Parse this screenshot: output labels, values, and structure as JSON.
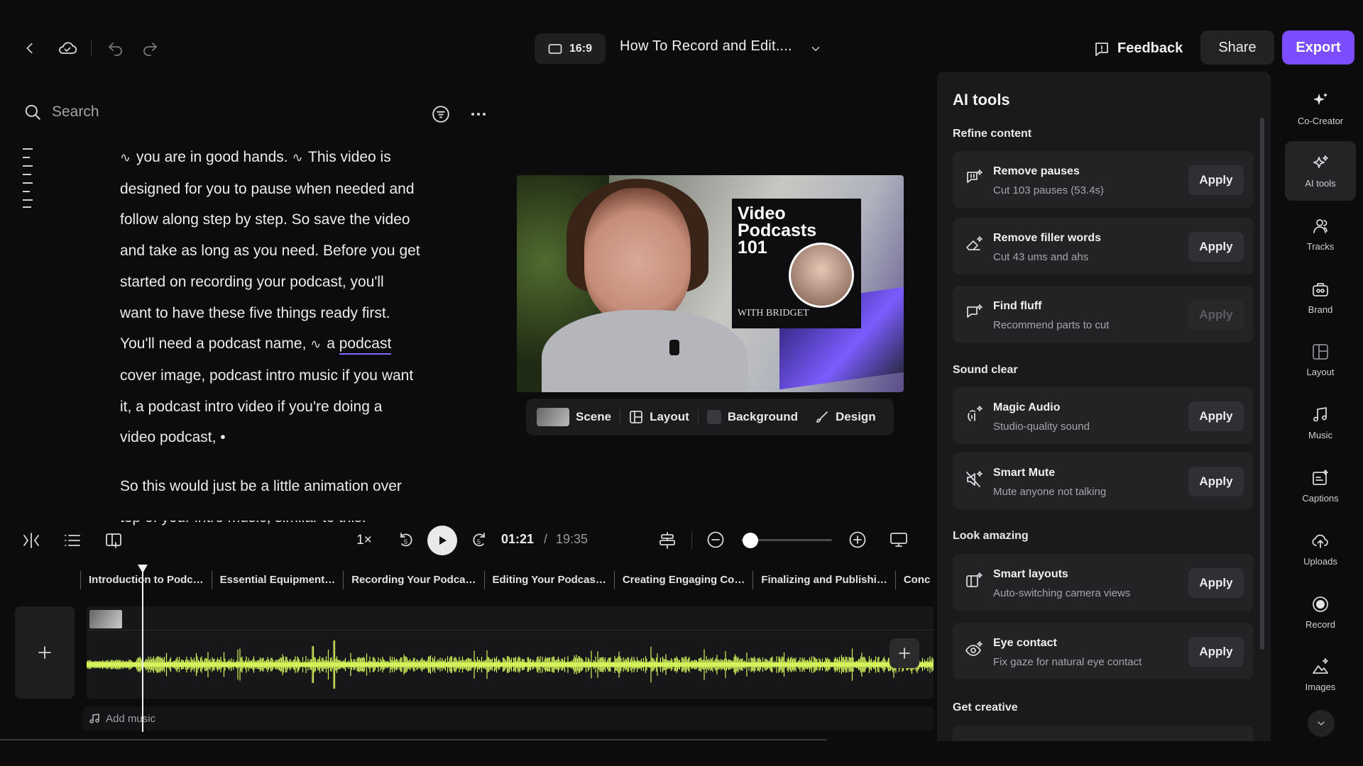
{
  "topbar": {
    "aspect_ratio": "16:9",
    "project_title": "How To Record and Edit....",
    "feedback_label": "Feedback",
    "share_label": "Share",
    "export_label": "Export"
  },
  "script_panel": {
    "search_placeholder": "Search",
    "paragraph1": {
      "l1": "you are in good hands.",
      "l1b": "This video is",
      "l2": "designed for you to pause when needed and",
      "l3": "follow along step by  step. So save the video",
      "l4": "and take as long as you need. Before you get",
      "l5": "started on recording your podcast, you'll",
      "l6": "want to have these five things ready first.",
      "l7": "You'll need a podcast name,",
      "l7b": "a",
      "l7link": "podcast",
      "l8": "cover image, podcast intro music if you want",
      "l9": "it, a podcast intro video if you're doing a",
      "l10": "video podcast,",
      "l10end": "•"
    },
    "paragraph2": {
      "l1": "So this would just be a little animation over",
      "l2": "top of your intro music, similar to this."
    }
  },
  "preview": {
    "cover_title_line1": "Video",
    "cover_title_line2": "Podcasts",
    "cover_title_line3": "101",
    "cover_subtitle": "WITH BRIDGET"
  },
  "scene_bar": {
    "scene_label": "Scene",
    "layout_label": "Layout",
    "background_label": "Background",
    "design_label": "Design"
  },
  "playback": {
    "speed": "1×",
    "current_time": "01:21",
    "separator": "/",
    "total_time": "19:35",
    "zoom_level": 0.1
  },
  "timeline": {
    "chapters": [
      "Introduction to Podc…",
      "Essential Equipment…",
      "Recording Your Podca…",
      "Editing Your Podcas…",
      "Creating Engaging Co…",
      "Finalizing and Publishi…",
      "Conc"
    ],
    "add_music_label": "Add music"
  },
  "ai_panel": {
    "title": "AI tools",
    "sections": {
      "refine": "Refine content",
      "sound": "Sound clear",
      "look": "Look amazing",
      "creative": "Get creative"
    },
    "tools": [
      {
        "title": "Remove pauses",
        "subtitle": "Cut 103 pauses (53.4s)",
        "action": "Apply"
      },
      {
        "title": "Remove filler words",
        "subtitle": "Cut 43 ums and ahs",
        "action": "Apply"
      },
      {
        "title": "Find fluff",
        "subtitle": "Recommend parts to cut",
        "action": "Apply"
      },
      {
        "title": "Magic Audio",
        "subtitle": "Studio-quality sound",
        "action": "Apply"
      },
      {
        "title": "Smart Mute",
        "subtitle": "Mute anyone not talking",
        "action": "Apply"
      },
      {
        "title": "Smart layouts",
        "subtitle": "Auto-switching camera views",
        "action": "Apply"
      },
      {
        "title": "Eye contact",
        "subtitle": "Fix gaze for natural eye contact",
        "action": "Apply"
      }
    ]
  },
  "rail": {
    "items": [
      "Co-Creator",
      "AI tools",
      "Tracks",
      "Brand",
      "Layout",
      "Music",
      "Captions",
      "Uploads",
      "Record",
      "Images"
    ]
  },
  "colors": {
    "accent": "#7b4dff",
    "waveform": "#d4f25a",
    "background": "#0c0c0d",
    "panel": "#1a1a1d"
  }
}
